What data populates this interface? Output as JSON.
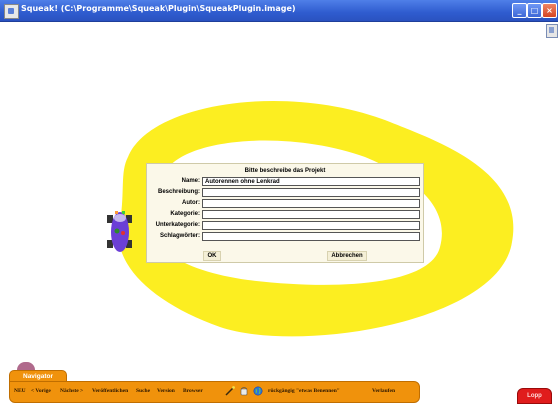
{
  "window": {
    "title": "Squeak! (C:\\Programme\\Squeak\\Plugin\\SqueakPlugin.image)"
  },
  "dialog": {
    "heading": "Bitte beschreibe das Projekt",
    "fields": [
      {
        "label": "Name:",
        "value": "Autorennen ohne Lenkrad"
      },
      {
        "label": "Beschreibung:",
        "value": ""
      },
      {
        "label": "Autor:",
        "value": ""
      },
      {
        "label": "Kategorie:",
        "value": ""
      },
      {
        "label": "Unterkategorie:",
        "value": ""
      },
      {
        "label": "Schlagwörter:",
        "value": ""
      }
    ],
    "ok_label": "OK",
    "cancel_label": "Abbrechen"
  },
  "navigator": {
    "tab_label": "Navigator",
    "items": [
      {
        "label": "NEU"
      },
      {
        "label": "< Vorige"
      },
      {
        "label": "Nächste >"
      },
      {
        "label": "Veröffentlichen"
      },
      {
        "label": "Suche"
      },
      {
        "label": "Version"
      },
      {
        "label": "Browser"
      },
      {
        "label": "rückgängig \"etwas Benennen\""
      },
      {
        "label": "Verlaufen"
      }
    ]
  },
  "stop_button": {
    "label": "Lopp"
  },
  "colors": {
    "track": "#fcee21",
    "navigator": "#f0920c",
    "dialog_bg": "#fbf8e9",
    "titlebar": "#2f5ccf",
    "stop": "#e01c1c"
  }
}
